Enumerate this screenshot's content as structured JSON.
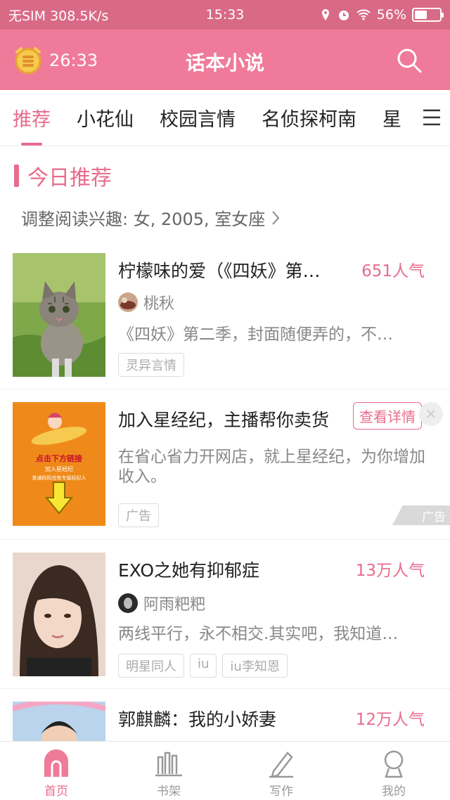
{
  "status": {
    "carrier": "无SIM 308.5K/s",
    "time": "15:33",
    "battery": "56%",
    "battery_level": 0.56
  },
  "header": {
    "timer": "26:33",
    "title": "话本小说"
  },
  "tabs": [
    {
      "label": "推荐",
      "active": true
    },
    {
      "label": "小花仙"
    },
    {
      "label": "校园言情"
    },
    {
      "label": "名侦探柯南"
    },
    {
      "label": "星"
    }
  ],
  "section": {
    "title": "今日推荐",
    "interest": "调整阅读兴趣: 女, 2005, 室女座"
  },
  "books": [
    {
      "title": "柠檬味的爱（《四妖》第…",
      "popularity": "651人气",
      "author": "桃秋",
      "desc": "《四妖》第二季，封面随便弄的，不…",
      "tags": [
        "灵异言情"
      ]
    },
    {
      "title": "EXO之她有抑郁症",
      "popularity": "13万人气",
      "author": "阿雨粑粑",
      "desc": "两线平行，永不相交.其实吧，我知道…",
      "tags": [
        "明星同人",
        "iu",
        "iu李知恩"
      ]
    },
    {
      "title": "郭麒麟：我的小娇妻",
      "popularity": "12万人气"
    }
  ],
  "ad": {
    "title": "加入星经纪，主播帮你卖货",
    "detail_button": "查看详情",
    "desc_line1": "在省心省力开网店，就上星经纪，为你增加",
    "desc_line2": "收入。",
    "tag": "广告",
    "mark": "广告",
    "cover_line1": "点击下方链接",
    "cover_line2": "加入星经纪",
    "cover_line3": "普通妈妈也有专属经纪人"
  },
  "bottom_nav": [
    {
      "label": "首页",
      "active": true
    },
    {
      "label": "书架"
    },
    {
      "label": "写作"
    },
    {
      "label": "我的"
    }
  ],
  "colors": {
    "accent": "#e86b8d",
    "header": "#f07a99",
    "status_bar": "#d96a86"
  }
}
